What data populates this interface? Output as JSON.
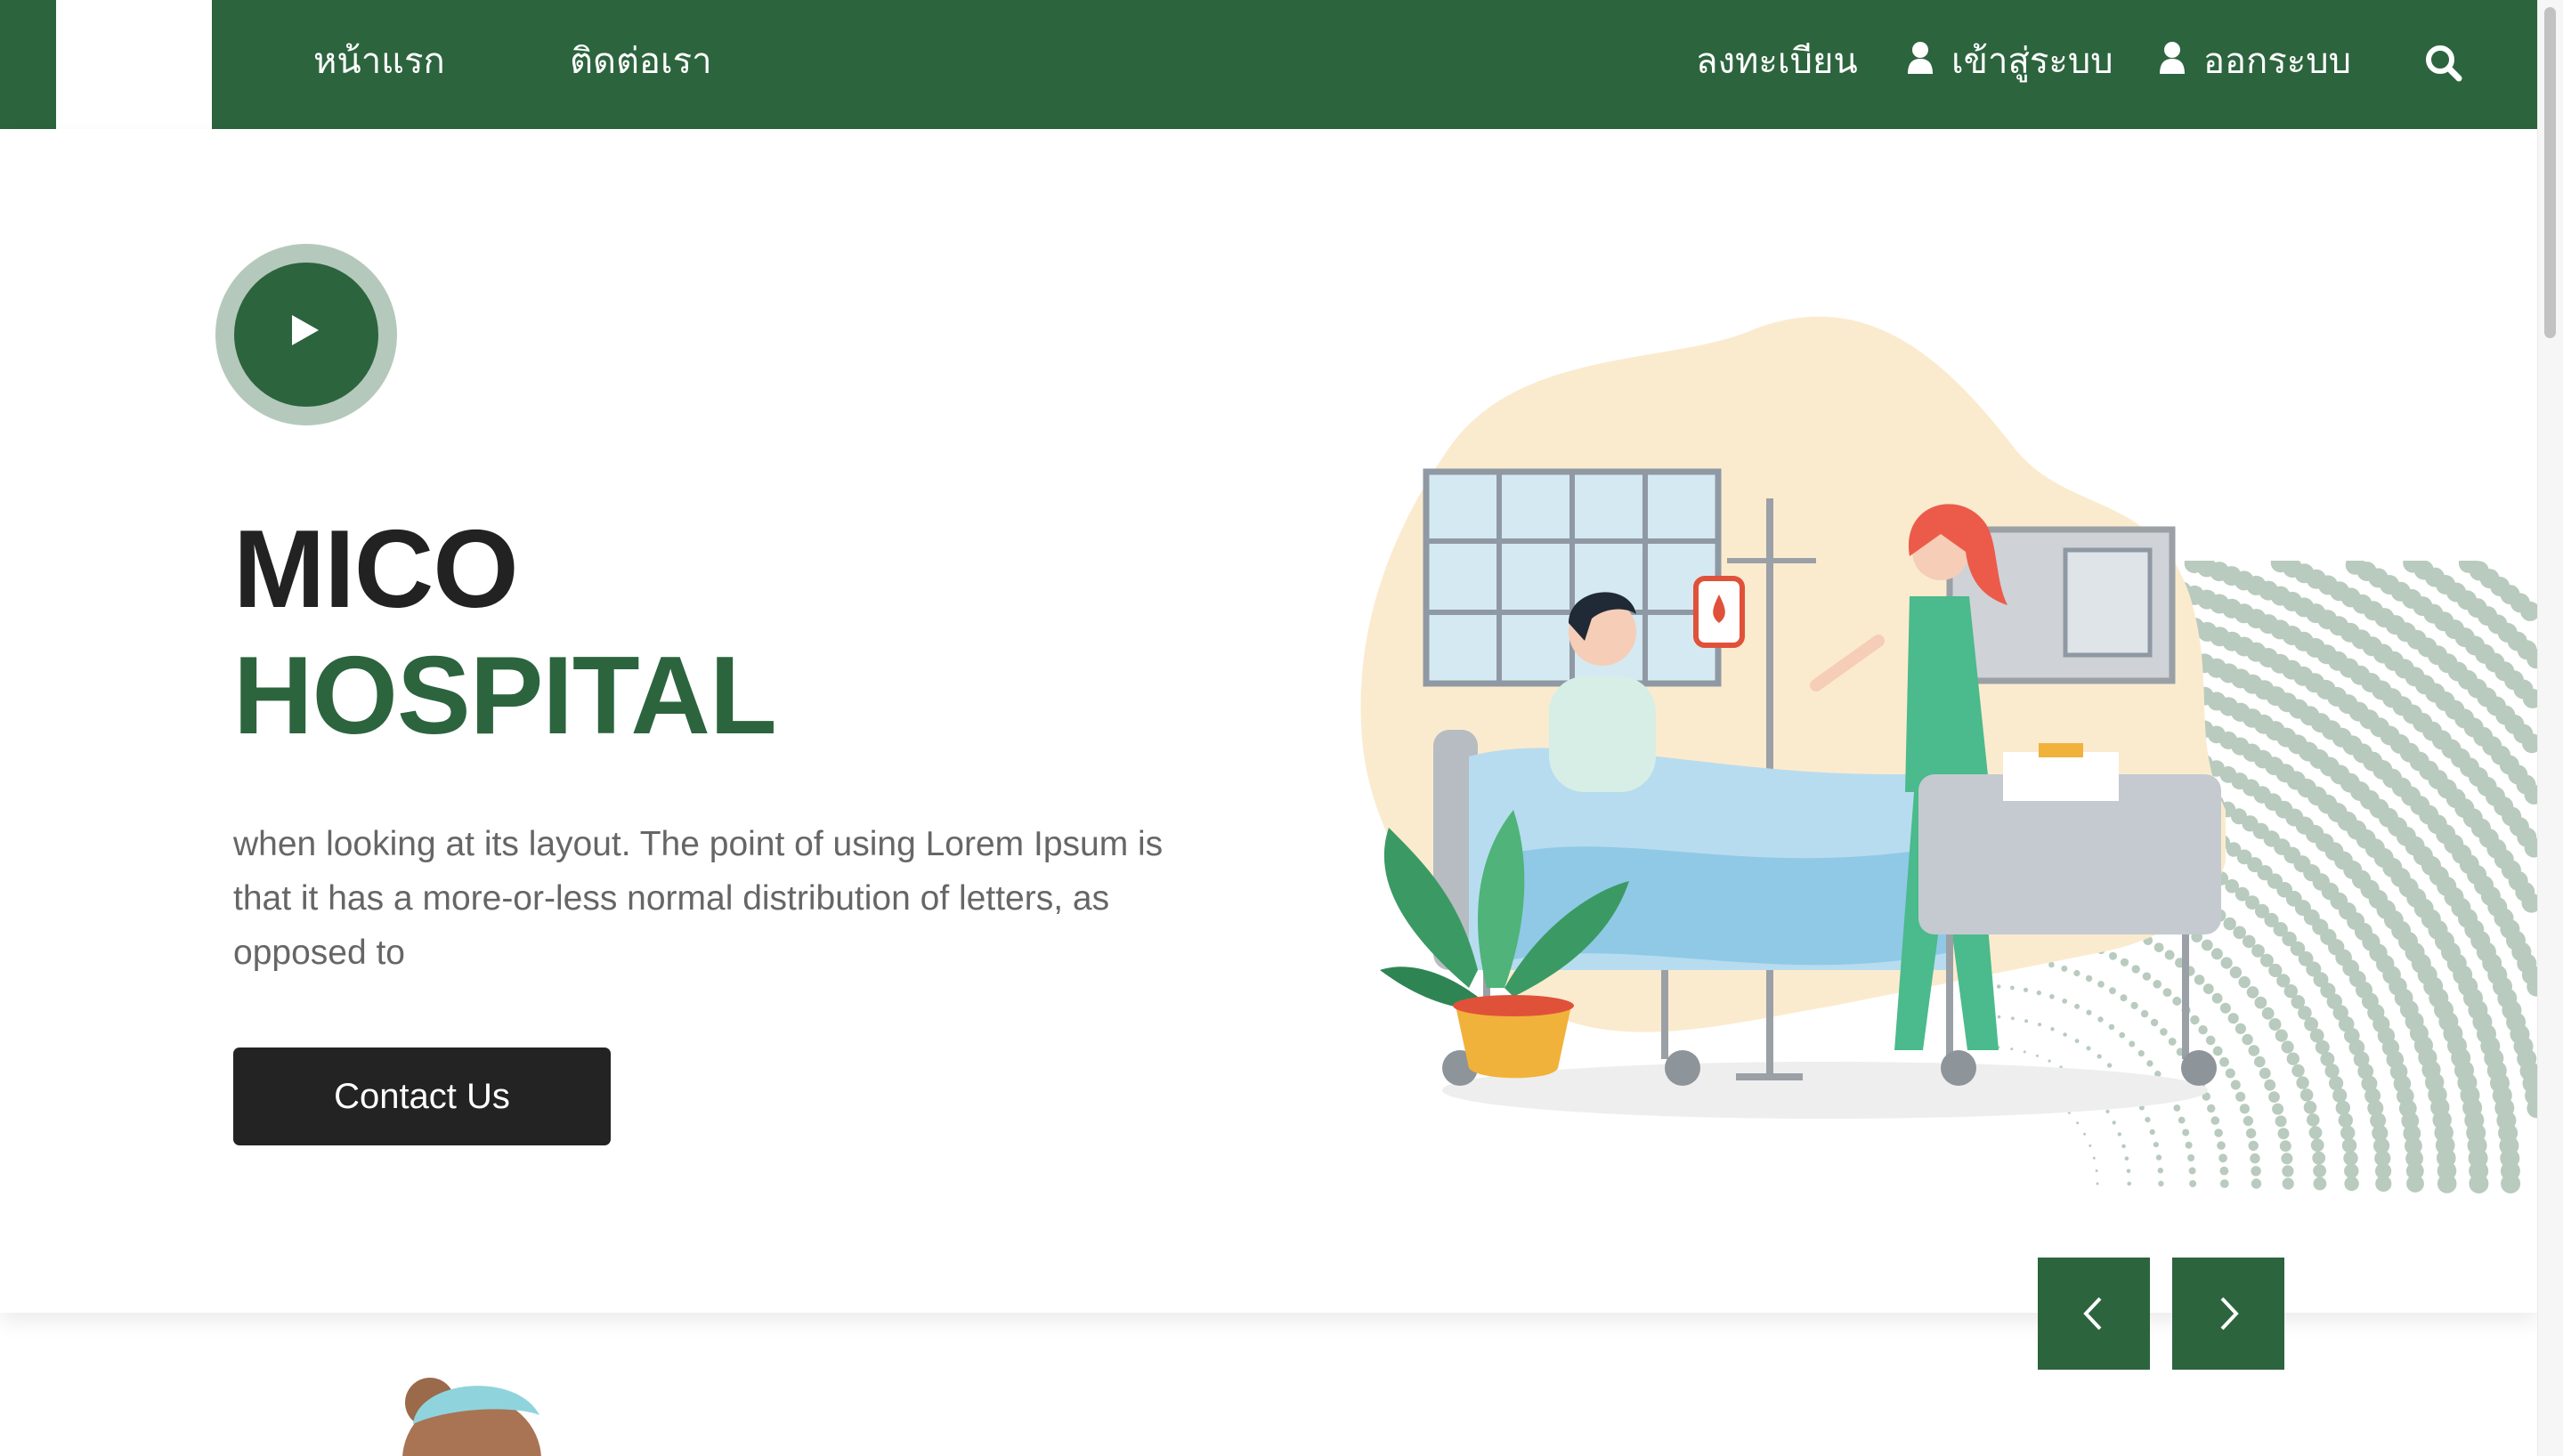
{
  "nav": {
    "left_links": [
      {
        "label": "หน้าแรก"
      },
      {
        "label": "ติดต่อเรา"
      }
    ],
    "right_links": [
      {
        "label": "ลงทะเบียน",
        "icon": null
      },
      {
        "label": "เข้าสู่ระบบ",
        "icon": "user-icon"
      },
      {
        "label": "ออกระบบ",
        "icon": "user-icon"
      }
    ],
    "search_icon": "search-icon"
  },
  "hero": {
    "title_line1": "MICO",
    "title_line2": "HOSPITAL",
    "description": "when looking at its layout. The point of using Lorem Ipsum is that it has a more-or-less normal distribution of letters, as opposed to",
    "cta_label": "Contact Us",
    "play_icon": "play-icon",
    "prev_icon": "chevron-left-icon",
    "next_icon": "chevron-right-icon"
  },
  "colors": {
    "brand_green": "#2c643e",
    "play_ring": "#b4c9bb",
    "dark_button": "#232323",
    "title_dark": "#222222",
    "text_gray": "#666666"
  }
}
